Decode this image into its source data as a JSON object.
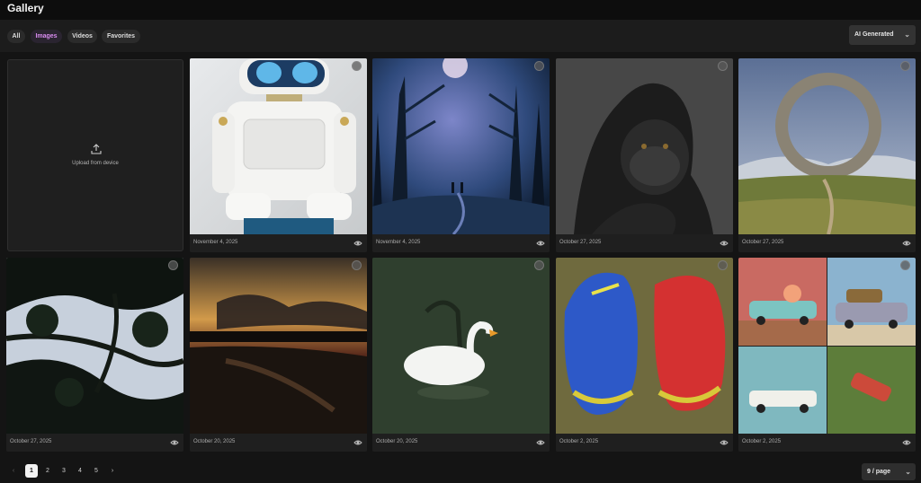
{
  "app": {
    "title": "Gallery"
  },
  "filters": {
    "tabs": [
      {
        "label": "All",
        "active": false
      },
      {
        "label": "Images",
        "active": true
      },
      {
        "label": "Videos",
        "active": false
      },
      {
        "label": "Favorites",
        "active": false
      }
    ],
    "source_select": {
      "value": "AI Generated"
    }
  },
  "upload": {
    "label": "Upload from device",
    "icon": "upload-icon"
  },
  "gallery": {
    "items": [
      {
        "subject": "robot",
        "date": "November 4, 2025"
      },
      {
        "subject": "misty-forest",
        "date": "November 4, 2025"
      },
      {
        "subject": "gorilla",
        "date": "October 27, 2025"
      },
      {
        "subject": "stone-ring",
        "date": "October 27, 2025"
      },
      {
        "subject": "tree-silhouette",
        "date": "October 27, 2025"
      },
      {
        "subject": "sunset-river",
        "date": "October 20, 2025"
      },
      {
        "subject": "swan",
        "date": "October 20, 2025"
      },
      {
        "subject": "shoes",
        "date": "October 2, 2025"
      },
      {
        "subject": "car-collage",
        "date": "October 2, 2025"
      }
    ]
  },
  "pagination": {
    "prev": "‹",
    "next": "›",
    "pages": [
      "1",
      "2",
      "3",
      "4",
      "5"
    ],
    "current": "1",
    "page_size": "9 / page"
  },
  "colors": {
    "accent": "#d98cf0",
    "background": "#141414",
    "card": "#1f1f1f"
  }
}
